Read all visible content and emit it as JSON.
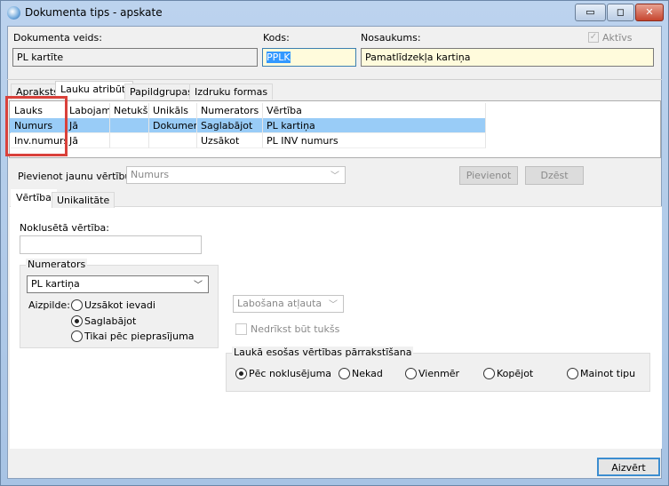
{
  "window": {
    "title": "Dokumenta tips - apskate",
    "minimize": "▭",
    "restore": "◻",
    "close": "✕"
  },
  "header": {
    "doc_type_label": "Dokumenta veids:",
    "doc_type_value": "PL kartīte",
    "code_label": "Kods:",
    "code_value": "PPLK",
    "name_label": "Nosaukums:",
    "name_value": "Pamatlīdzekļa kartiņa",
    "active_label": "Aktīvs",
    "active_checked": true
  },
  "tabs": [
    "Apraksts",
    "Lauku atribūti",
    "Papildgrupas",
    "Izdruku formas"
  ],
  "grid": {
    "columns": [
      "Lauks",
      "Labojams",
      "Netukšs",
      "Unikāls",
      "Numerators",
      "Vērtība"
    ],
    "rows": [
      [
        "Numurs",
        "Jā",
        "",
        "Dokument",
        "Saglabājot",
        "PL kartiņa"
      ],
      [
        "Inv.numurs",
        "Jā",
        "",
        "",
        "Uzsākot",
        "PL INV numurs"
      ]
    ]
  },
  "add": {
    "label": "Pievienot jaunu vērtību:",
    "combo_value": "Numurs",
    "add_button": "Pievienot",
    "delete_button": "Dzēst"
  },
  "subtabs": [
    "Vērtība",
    "Unikalitāte"
  ],
  "value_tab": {
    "default_label": "Noklusētā vērtība:",
    "default_value": "",
    "numerator_group": "Numerators",
    "numerator_value": "PL kartiņa",
    "fill_label": "Aizpilde:",
    "fill_options": [
      "Uzsākot ievadi",
      "Saglabājot",
      "Tikai pēc pieprasījuma"
    ],
    "fill_selected": 1,
    "edit_combo": "Labošana atļauta",
    "not_empty_label": "Nedrīkst būt tukšs",
    "overwrite_group": "Laukā esošas vērtības pārrakstīšana",
    "overwrite_options": [
      "Pēc noklusējuma",
      "Nekad",
      "Vienmēr",
      "Kopējot",
      "Mainot tipu"
    ],
    "overwrite_selected": 0
  },
  "footer": {
    "close_button": "Aizvērt"
  },
  "colors": {
    "selection": "#99ccf7",
    "highlight": "#d9413b",
    "input_yellow": "#fffbdc"
  }
}
